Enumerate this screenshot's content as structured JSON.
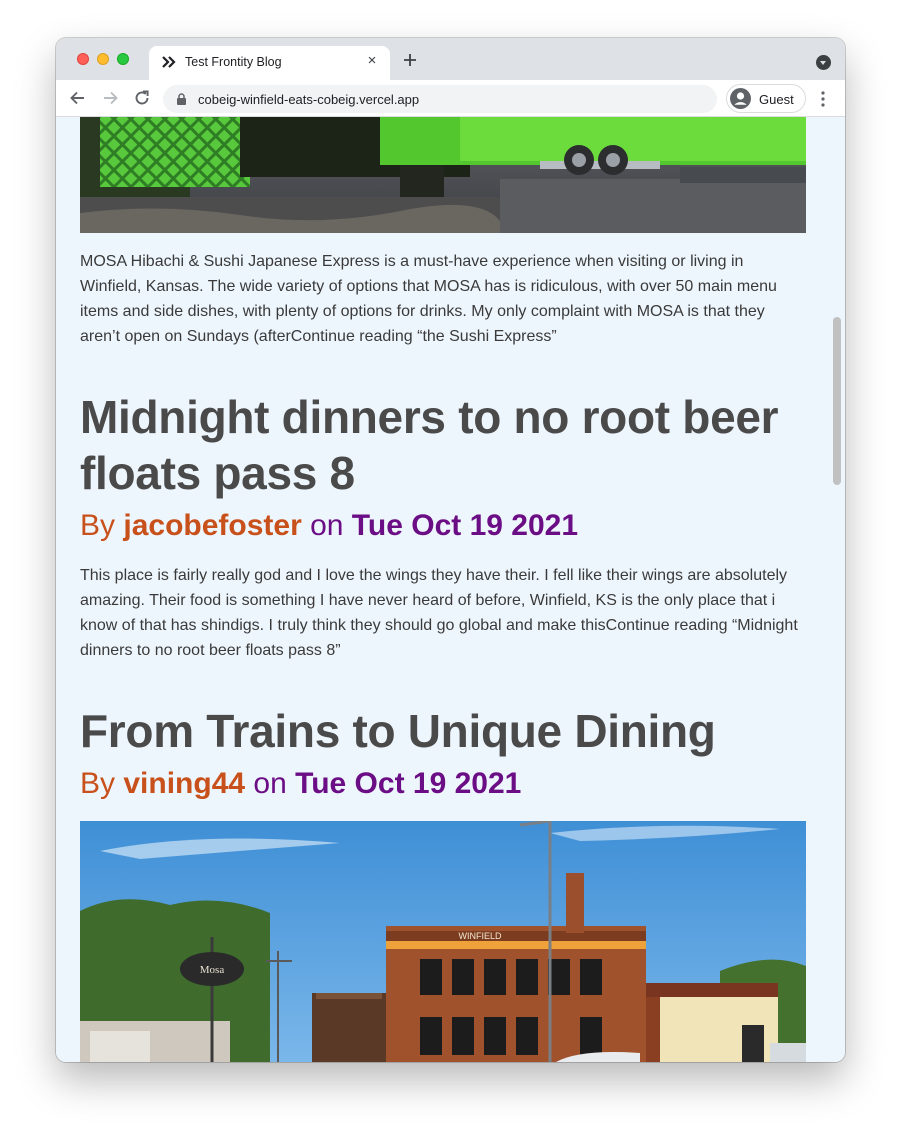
{
  "browser": {
    "tab_title": "Test Frontity Blog",
    "tab_close": "×",
    "url": "cobeig-winfield-eats-cobeig.vercel.app",
    "profile_label": "Guest"
  },
  "intro": {
    "excerpt": "MOSA Hibachi & Sushi Japanese Express is a must-have experience when visiting or living in Winfield, Kansas. The wide variety of options that MOSA has is ridiculous, with over 50 main menu items and side dishes, with plenty of options for drinks. My only complaint with MOSA is that they aren’t open on Sundays (afterContinue reading “the Sushi Express”"
  },
  "posts": [
    {
      "title": "Midnight dinners to no root beer floats pass 8",
      "by": "By ",
      "author": "jacobefoster",
      "on": " on ",
      "date": "Tue Oct 19 2021",
      "excerpt": "This place is fairly really god and I love the wings they have their. I fell like their wings are absolutely amazing. Their food is something I have never heard of before, Winfield, KS is the only place that i know of that has shindigs. I truly think they should go global and make thisContinue reading “Midnight dinners to no root beer floats pass 8”"
    },
    {
      "title": "From Trains to Unique Dining",
      "by": "By ",
      "author": "vining44",
      "on": " on ",
      "date": "Tue Oct 19 2021"
    }
  ],
  "image_signs": {
    "building_name": "WINFIELD",
    "oval_sign": "Mosa"
  },
  "colors": {
    "author": "#c8501b",
    "date": "#6b0e85",
    "title": "#4a4a4a",
    "page_bg": "#eef6fd"
  },
  "icons": [
    "frontity-favicon-icon",
    "close-icon",
    "plus-icon",
    "chevron-down-icon",
    "back-arrow-icon",
    "forward-arrow-icon",
    "reload-icon",
    "lock-icon",
    "avatar-icon",
    "more-vert-icon"
  ]
}
